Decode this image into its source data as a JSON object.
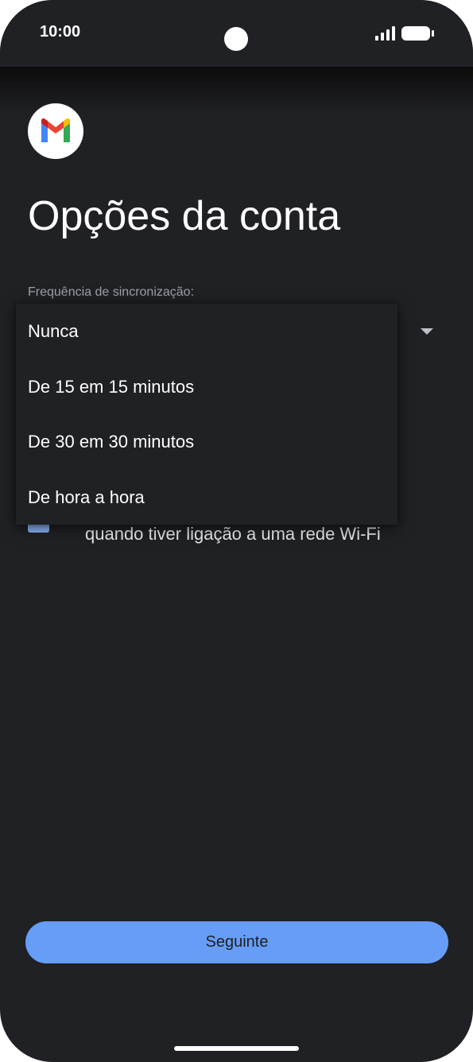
{
  "status_bar": {
    "time": "10:00"
  },
  "icons": {
    "app_logo": "gmail-logo-icon",
    "signal": "signal-icon",
    "battery": "battery-icon",
    "dropdown": "dropdown-arrow-icon"
  },
  "page": {
    "title": "Opções da conta"
  },
  "sync": {
    "label": "Frequência de sincronização:",
    "selected": "Nunca",
    "options": [
      "Nunca",
      "De 15 em 15 minutos",
      "De 30 em 30 minutos",
      "De hora a hora"
    ]
  },
  "wifi_option": {
    "checked": true,
    "label": "quando tiver ligação a uma rede Wi-Fi"
  },
  "actions": {
    "next_label": "Seguinte"
  },
  "colors": {
    "background": "#202124",
    "accent": "#669df6",
    "checkbox": "#8ab4f8"
  }
}
